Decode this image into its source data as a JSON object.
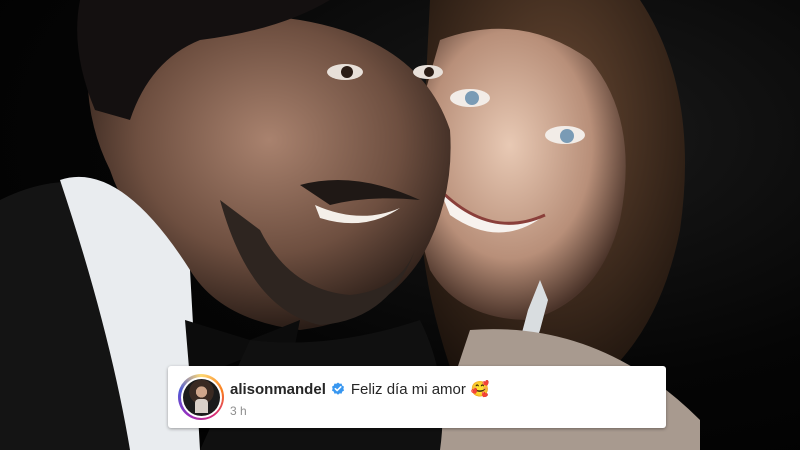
{
  "post": {
    "photo_alt": "photo"
  },
  "comment": {
    "username": "alisonmandel",
    "text": "Feliz día mi amor",
    "emoji": "🥰",
    "timestamp": "3 h",
    "verified_icon": "verified-badge-icon",
    "colors": {
      "username": "#262626",
      "text": "#262626",
      "timestamp": "#8e8e8e",
      "verified": "#3897f0",
      "card_background": "#ffffff"
    }
  }
}
